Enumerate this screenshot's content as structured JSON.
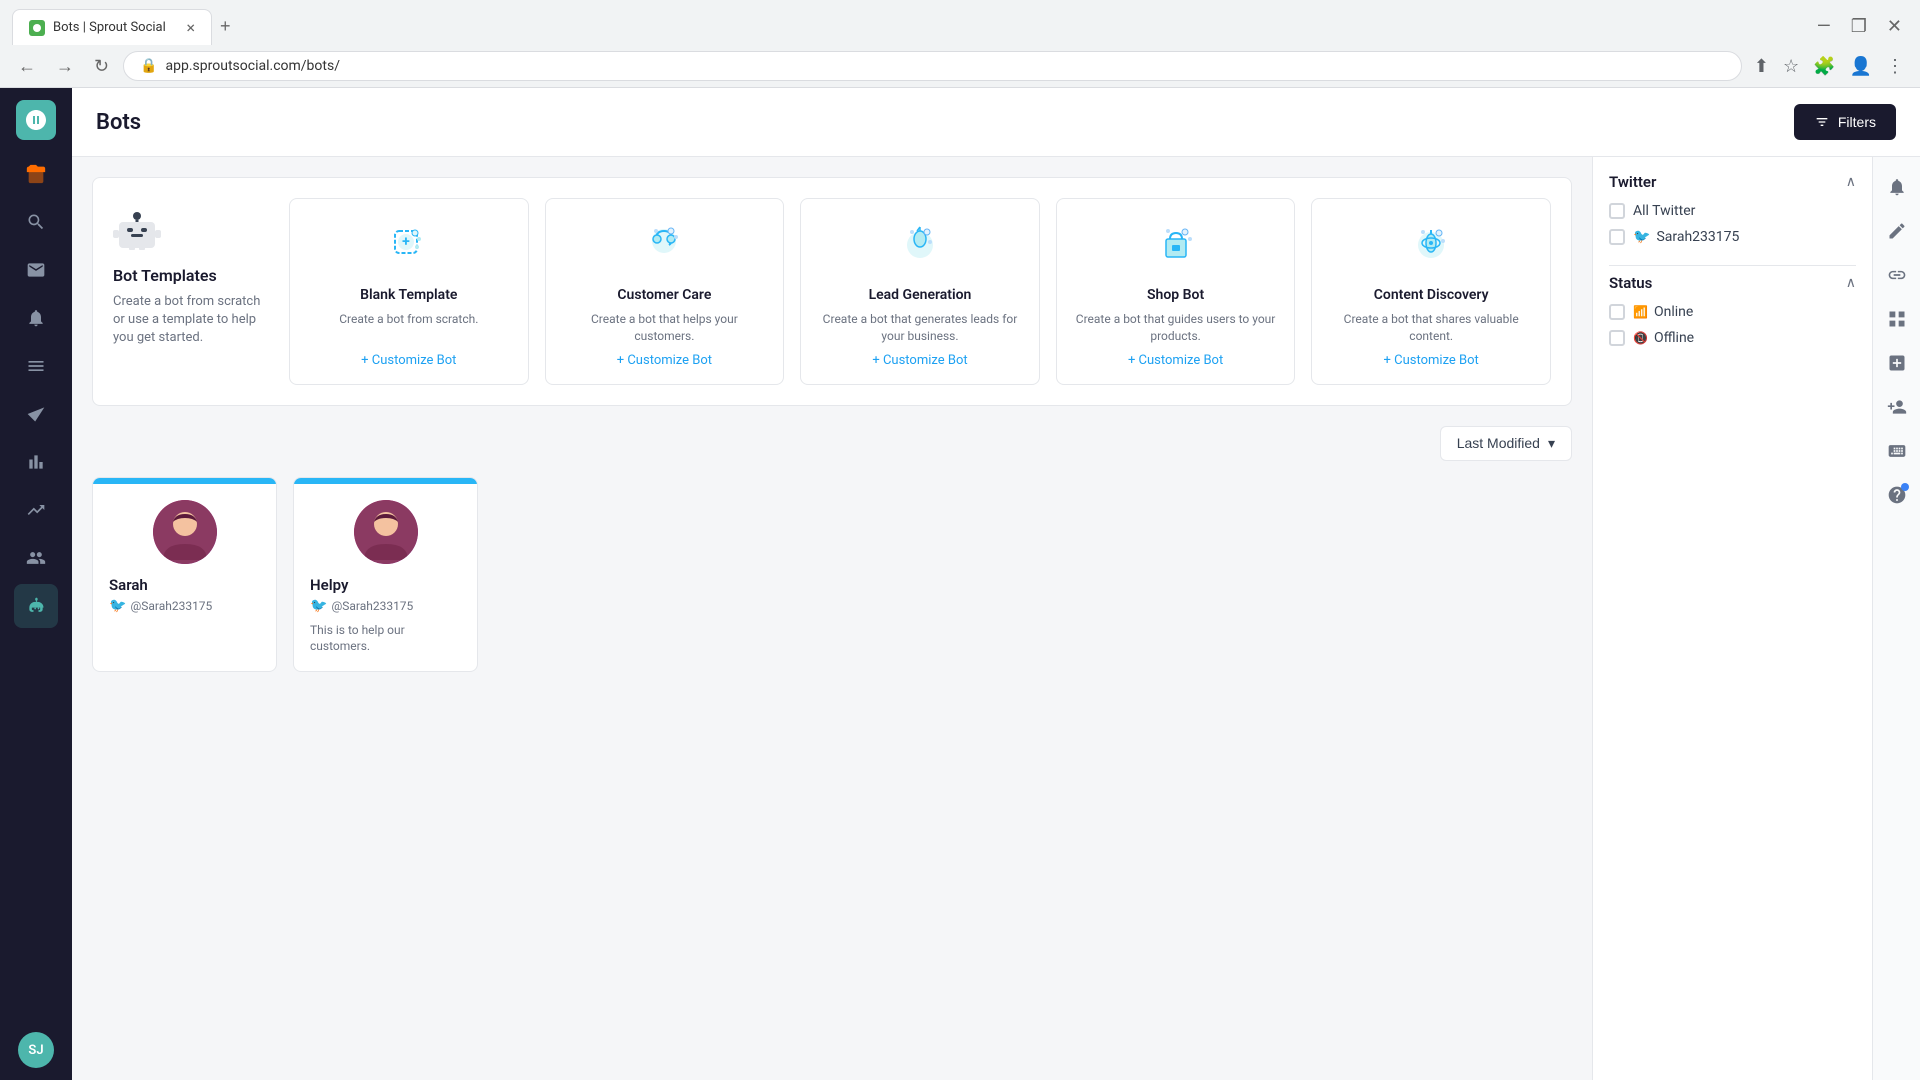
{
  "browser": {
    "tab_title": "Bots | Sprout Social",
    "tab_close": "×",
    "new_tab": "+",
    "url": "app.sproutsocial.com/bots/",
    "window_minimize": "—",
    "window_maximize": "❐",
    "window_close": "✕"
  },
  "header": {
    "title": "Bots",
    "filters_label": "Filters"
  },
  "templates": {
    "intro_title": "Bot Templates",
    "intro_desc": "Create a bot from scratch or use a template to help you get started.",
    "cards": [
      {
        "id": "blank",
        "title": "Blank Template",
        "desc": "Create a bot from scratch.",
        "customize_label": "Customize Bot"
      },
      {
        "id": "customer-care",
        "title": "Customer Care",
        "desc": "Create a bot that helps your customers.",
        "customize_label": "Customize Bot"
      },
      {
        "id": "lead-gen",
        "title": "Lead Generation",
        "desc": "Create a bot that generates leads for your business.",
        "customize_label": "Customize Bot"
      },
      {
        "id": "shop-bot",
        "title": "Shop Bot",
        "desc": "Create a bot that guides users to your products.",
        "customize_label": "Customize Bot"
      },
      {
        "id": "content-discovery",
        "title": "Content Discovery",
        "desc": "Create a bot that shares valuable content.",
        "customize_label": "Customize Bot"
      }
    ]
  },
  "sort": {
    "label": "Last Modified",
    "chevron": "▾"
  },
  "bots": [
    {
      "name": "Sarah",
      "handle": "@Sarah233175",
      "description": ""
    },
    {
      "name": "Helpy",
      "handle": "@Sarah233175",
      "description": "This is to help our customers."
    }
  ],
  "right_panel": {
    "twitter_section": {
      "title": "Twitter",
      "items": [
        {
          "label": "All Twitter",
          "checked": false
        },
        {
          "label": "Sarah233175",
          "checked": false,
          "is_twitter": true
        }
      ]
    },
    "status_section": {
      "title": "Status",
      "items": [
        {
          "label": "Online",
          "status": "online"
        },
        {
          "label": "Offline",
          "status": "offline"
        }
      ]
    }
  },
  "sidebar": {
    "avatar_initials": "SJ",
    "items": [
      {
        "icon": "home",
        "label": "Home"
      },
      {
        "icon": "folder",
        "label": "Feeds",
        "active": true,
        "orange": true
      },
      {
        "icon": "search",
        "label": "Search"
      },
      {
        "icon": "inbox",
        "label": "Inbox"
      },
      {
        "icon": "bell",
        "label": "Notifications"
      },
      {
        "icon": "list",
        "label": "Publishing"
      },
      {
        "icon": "send",
        "label": "Campaigns"
      },
      {
        "icon": "bar-chart",
        "label": "Reports"
      },
      {
        "icon": "bar-chart-2",
        "label": "Analytics"
      },
      {
        "icon": "users",
        "label": "Listening"
      },
      {
        "icon": "bot",
        "label": "Bots"
      }
    ]
  }
}
